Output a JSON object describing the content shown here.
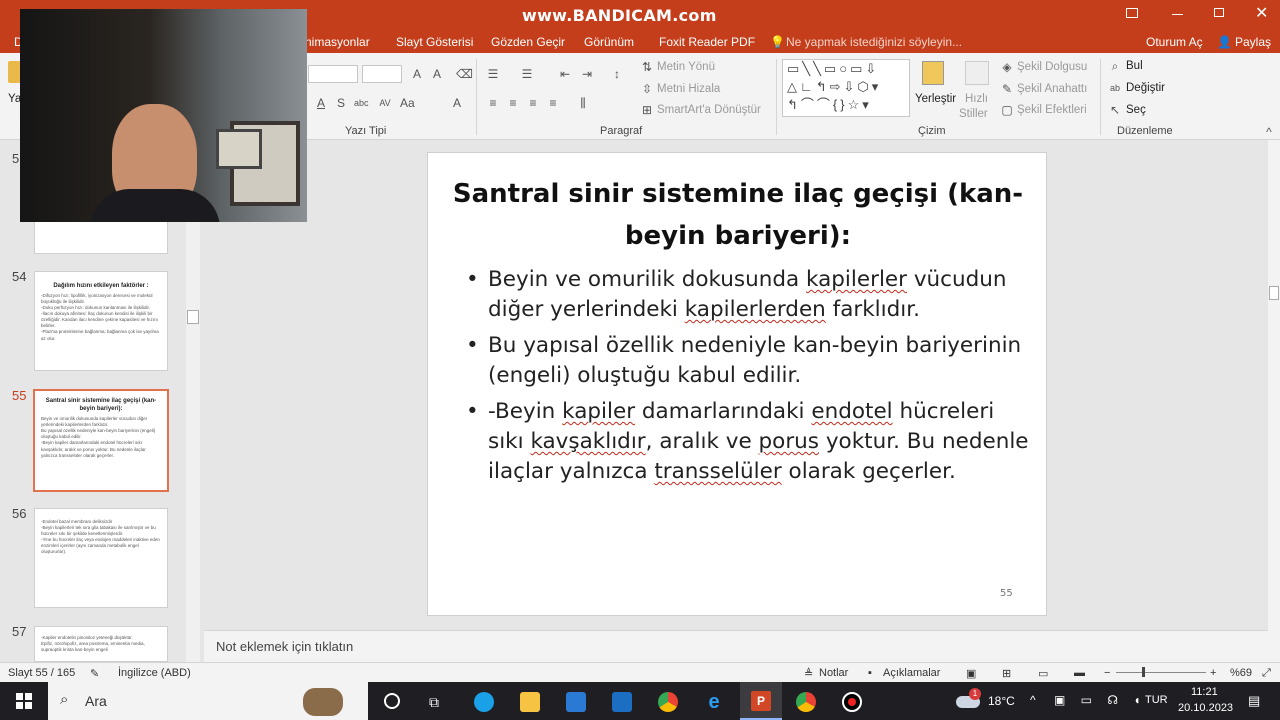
{
  "watermark": "www.BANDICAM.com",
  "menu": {
    "file_cut": "D",
    "animations": "nimasyonlar",
    "slideshow": "Slayt Gösterisi",
    "review": "Gözden Geçir",
    "view": "Görünüm",
    "foxit": "Foxit Reader PDF",
    "tellme": "Ne yapmak istediğinizi söyleyin...",
    "signin": "Oturum Aç",
    "share": "Paylaş"
  },
  "ribbon": {
    "paste_cut": "Ya",
    "font_group": "Yazı Tipi",
    "paragraph_group": "Paragraf",
    "text_direction": "Metin Yönü",
    "align_text": "Metni Hizala",
    "smartart": "SmartArt'a Dönüştür",
    "drawing_group": "Çizim",
    "arrange": "Yerleştir",
    "quick_styles_1": "Hızlı",
    "quick_styles_2": "Stiller",
    "shape_fill": "Şekil Dolgusu",
    "shape_outline": "Şekil Anahattı",
    "shape_effects": "Şekil Efektleri",
    "find": "Bul",
    "replace": "Değiştir",
    "select": "Seç",
    "editing_group": "Düzenleme"
  },
  "thumbnails": [
    {
      "num": "5",
      "title": "",
      "lines": []
    },
    {
      "num": "54",
      "title": "Dağılım hızını etkileyen faktörler :",
      "lines": [
        "-Difüzyon hızı: lipofillik, iyonizasyon derecesi ve molekül büyüklüğü ile ilişkilidir.",
        "-Doku perfüzyon hızı: dokunun kanlanması ile ilişkilidir.",
        "-İlacın dokuya afinitesi: İlaç dokunun kendisi ile ilişkili bir özelliğidir. Kandan ilacı kendine çekme kapasitesi ve hızını belirler.",
        "-Plazma proteinlerine bağlanma: bağlanma çok ise yayılma az olur."
      ]
    },
    {
      "num": "55",
      "title": "Santral sinir sistemine ilaç geçişi (kan-beyin bariyeri):",
      "lines": [
        "Beyin ve omurilik dokusunda kapilerler vücudun diğer yerlerindeki kapilerlerden farklıdır.",
        "Bu yapısal özellik nedeniyle kan-beyin bariyerinin (engeli) oluştuğu kabul edilir.",
        "-Beyin kapiler damarlarındaki endotel hücreleri sıkı kavşaklıdır, aralık ve porus yoktur. Bu nedenle ilaçlar yalnızca transselüler olarak geçerler."
      ]
    },
    {
      "num": "56",
      "title": "",
      "lines": [
        "-Endotel bazal membranı deliksizdir",
        "-Beyin kapilerleri tek sıra glia tabakası ile sarılmıştır ve bu hücreler sıkı bir şekilde kenetlenmişlerdir.",
        "-Yine bu hücreler ilaç veya endojen maddeleri inaktive eden enzimleri içerirler (aynı zamanda metabolik engel oluştururlar)."
      ]
    },
    {
      "num": "57",
      "title": "",
      "lines": [
        "-Kapiler endotelin pinositoz yeteneği düşüktür.",
        "Epifiz, nörohipofiz, area postrema, eminentia media, supraoptik krista kan-beyin engeli"
      ]
    }
  ],
  "slide": {
    "title": "Santral sinir sistemine ilaç geçişi (kan-beyin bariyeri):",
    "bullets": [
      "Beyin ve omurilik dokusunda kapilerler vücudun diğer yerlerindeki kapilerlerden farklıdır.",
      "Bu yapısal özellik nedeniyle kan-beyin bariyerinin (engeli) oluştuğu kabul edilir.",
      "-Beyin kapiler damarlarındaki endotel hücreleri sıkı kavşaklıdır, aralık ve porus yoktur. Bu nedenle ilaçlar yalnızca transselüler olarak geçerler."
    ],
    "number": "55"
  },
  "notes_placeholder": "Not eklemek için tıklatın",
  "status": {
    "slide": "Slayt 55 / 165",
    "language": "İngilizce (ABD)",
    "notes": "Notlar",
    "comments": "Açıklamalar",
    "zoom": "%69"
  },
  "taskbar": {
    "search": "Ara",
    "temp": "18°C",
    "lang": "TUR",
    "time": "11:21",
    "date": "20.10.2023",
    "badge": "1"
  }
}
